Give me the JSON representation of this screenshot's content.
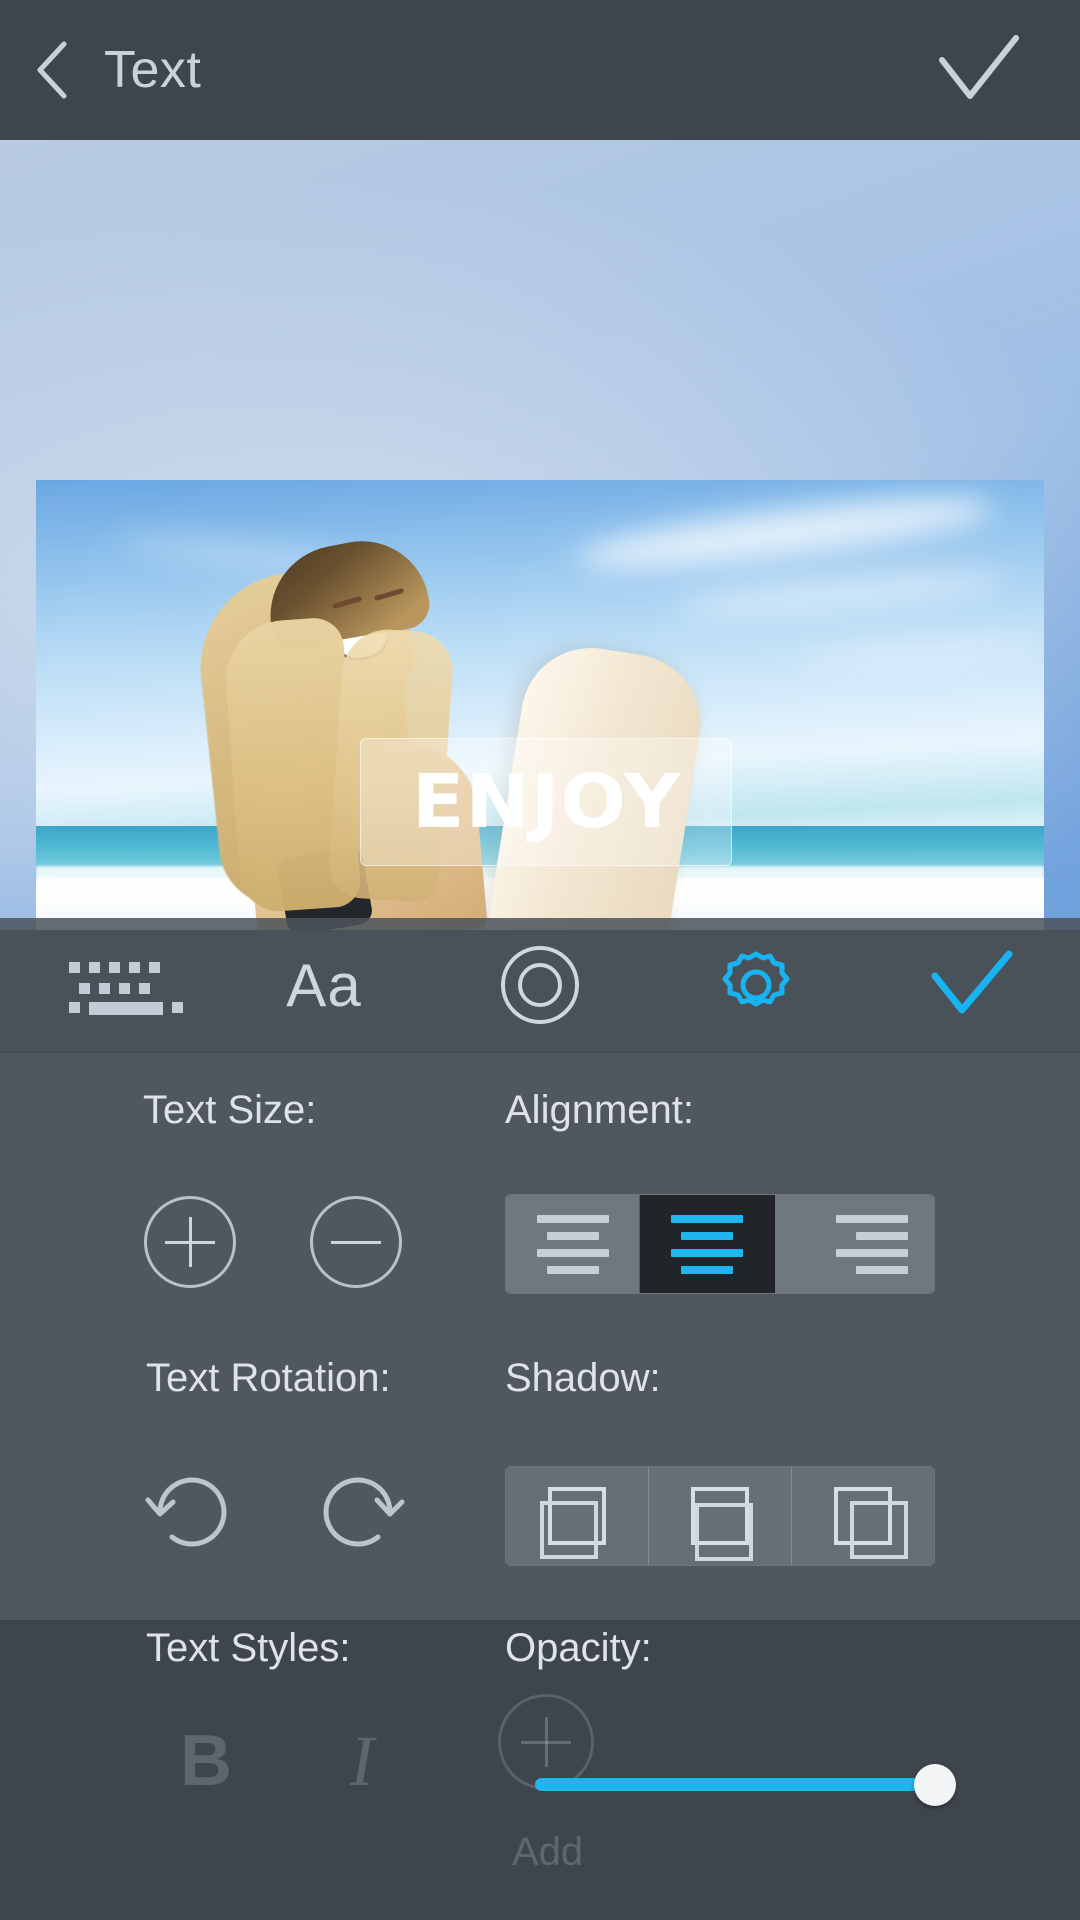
{
  "topbar": {
    "back_icon": "chevron-left-icon",
    "title": "Text",
    "confirm_icon": "check-icon"
  },
  "photo": {
    "overlay_text": "ENJOY",
    "description": "Smiling blonde woman holding a surfboard at the beach under a blue sky"
  },
  "icon_toolbar": {
    "items": [
      {
        "name": "keyboard-icon",
        "label": "",
        "active": false
      },
      {
        "name": "font-icon",
        "label": "Aa",
        "active": false
      },
      {
        "name": "color-icon",
        "label": "",
        "active": false
      },
      {
        "name": "settings-icon",
        "label": "",
        "active": true
      },
      {
        "name": "confirm-icon",
        "label": "",
        "active": true
      }
    ]
  },
  "settings": {
    "text_size": {
      "label": "Text Size:",
      "increase_label": "+",
      "decrease_label": "−"
    },
    "alignment": {
      "label": "Alignment:",
      "options": [
        "left",
        "center",
        "right"
      ],
      "selected": "center"
    },
    "text_rotation": {
      "label": "Text Rotation:",
      "rotate_ccw": "rotate-left-icon",
      "rotate_cw": "rotate-right-icon"
    },
    "shadow": {
      "label": "Shadow:",
      "options": [
        "shadow-left",
        "shadow-bottom",
        "shadow-right"
      ],
      "selected": null
    },
    "text_styles": {
      "label": "Text Styles:",
      "bold_label": "B",
      "italic_label": "I",
      "bold_active": false,
      "italic_active": false
    },
    "opacity": {
      "label": "Opacity:",
      "value": 100,
      "min": 0,
      "max": 100
    },
    "add_button": {
      "label": "Add",
      "icon": "plus-circle-icon"
    }
  },
  "colors": {
    "topbar_bg": "#3e454c",
    "panel_bg": "#50575e",
    "panel_alt_bg": "#3e454c",
    "accent": "#1fb6f0",
    "text_primary": "#dde3e9",
    "segment_bg": "#6f777f",
    "segment_active_bg": "#212428"
  }
}
